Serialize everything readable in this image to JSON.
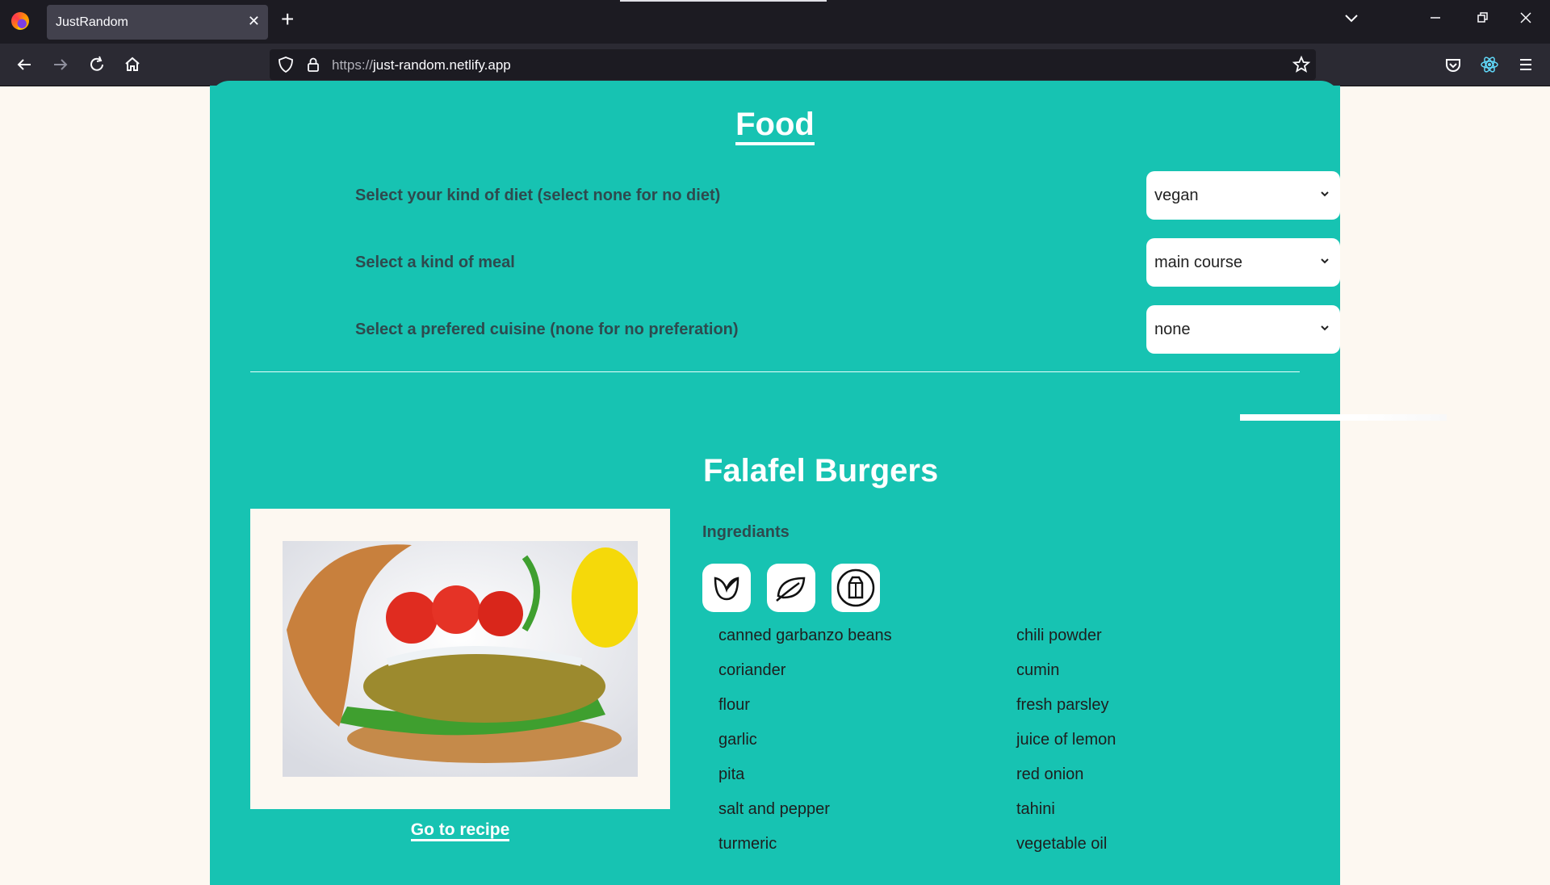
{
  "browser": {
    "tab_title": "JustRandom",
    "url_protocol": "https://",
    "url_host": "just-random.netlify.app"
  },
  "food": {
    "title": "Food",
    "filters": [
      {
        "label": "Select your kind of diet (select none for no diet)",
        "value": "vegan"
      },
      {
        "label": "Select a kind of meal",
        "value": "main course"
      },
      {
        "label": "Select a prefered cuisine (none for no preferation)",
        "value": "none"
      }
    ]
  },
  "recipe": {
    "title": "Falafel Burgers",
    "link_label": "Go to recipe",
    "ingredients_heading": "Ingrediants",
    "badges": [
      "vegan-icon",
      "vegetarian-leaf-icon",
      "dairy-free-icon"
    ],
    "ingredients_left": [
      "canned garbanzo beans",
      "coriander",
      "flour",
      "garlic",
      "pita",
      "salt and pepper",
      "turmeric"
    ],
    "ingredients_right": [
      "chili powder",
      "cumin",
      "fresh parsley",
      "juice of lemon",
      "red onion",
      "tahini",
      "vegetable oil"
    ]
  },
  "colors": {
    "accent": "#17c3b2",
    "page_bg": "#fdf8f1",
    "label_text": "#2e4a4e"
  }
}
